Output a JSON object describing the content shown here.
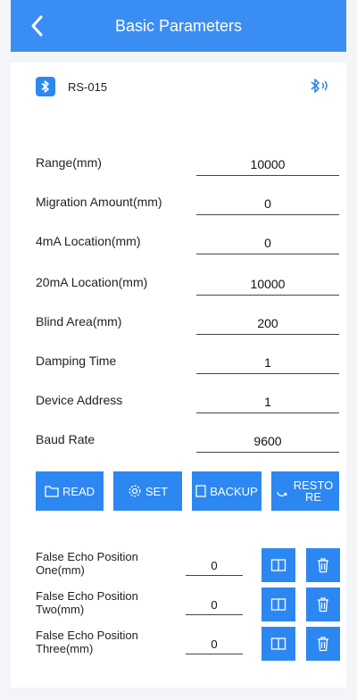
{
  "header": {
    "title": "Basic Parameters",
    "back_icon": "chevron-left-icon"
  },
  "device": {
    "name": "RS-015",
    "badge_icon": "bluetooth-icon",
    "status_icon": "bluetooth-connected-icon"
  },
  "params": [
    {
      "label": "Range(mm)",
      "value": "10000"
    },
    {
      "label": "Migration Amount(mm)",
      "value": "0"
    },
    {
      "label": "4mA Location(mm)",
      "value": "0"
    },
    {
      "label": "20mA Location(mm)",
      "value": "10000"
    },
    {
      "label": "Blind Area(mm)",
      "value": "200"
    },
    {
      "label": "Damping Time",
      "value": "1"
    },
    {
      "label": "Device Address",
      "value": "1"
    },
    {
      "label": "Baud Rate",
      "value": "9600"
    }
  ],
  "actions": {
    "read": "READ",
    "set": "SET",
    "backup": "BACKUP",
    "restore": "RESTORE"
  },
  "false_echo": [
    {
      "label": "False Echo Position One(mm)",
      "value": "0"
    },
    {
      "label": "False Echo Position Two(mm)",
      "value": "0"
    },
    {
      "label": "False Echo Position Three(mm)",
      "value": "0"
    }
  ],
  "colors": {
    "primary": "#3a8ef3",
    "button": "#2d87f0",
    "background": "#f4f5f9"
  }
}
